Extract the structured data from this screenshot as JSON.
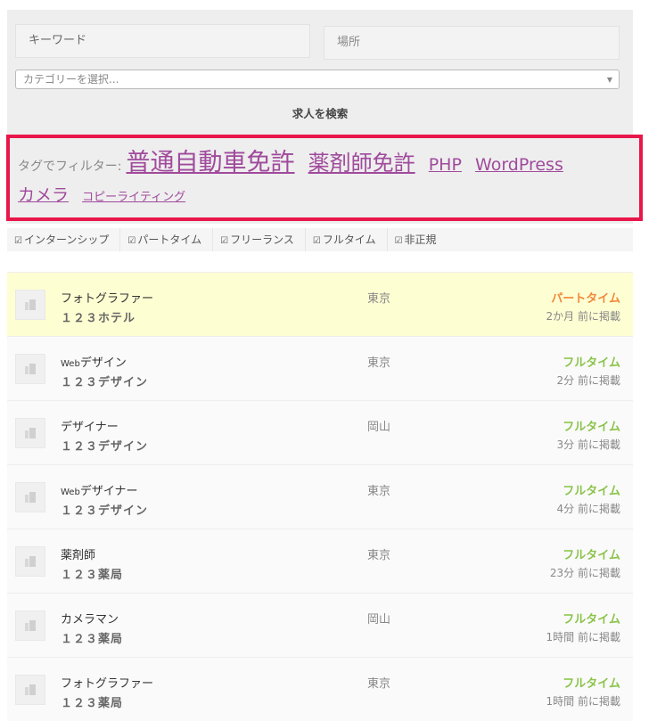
{
  "search": {
    "keyword_placeholder": "キーワード",
    "location_placeholder": "場所",
    "category_placeholder": "カテゴリーを選択...",
    "submit_label": "求人を検索"
  },
  "tags": {
    "label": "タグでフィルター:",
    "items": [
      "普通自動車免許",
      "薬剤師免許",
      "PHP",
      "WordPress",
      "カメラ",
      "コピーライティング"
    ]
  },
  "filters": [
    "インターンシップ",
    "パートタイム",
    "フリーランス",
    "フルタイム",
    "非正規"
  ],
  "jobs": [
    {
      "title": "フォトグラファー",
      "title_prefix": "",
      "company": "１２３ホテル",
      "location": "東京",
      "type": "パートタイム",
      "posted": "2か月 前に掲載"
    },
    {
      "title": "デザイン",
      "title_prefix": "Web",
      "company": "１２３デザイン",
      "location": "東京",
      "type": "フルタイム",
      "posted": "2分 前に掲載"
    },
    {
      "title": "デザイナー",
      "title_prefix": "",
      "company": "１２３デザイン",
      "location": "岡山",
      "type": "フルタイム",
      "posted": "3分 前に掲載"
    },
    {
      "title": "デザイナー",
      "title_prefix": "Web",
      "company": "１２３デザイン",
      "location": "東京",
      "type": "フルタイム",
      "posted": "4分 前に掲載"
    },
    {
      "title": "薬剤師",
      "title_prefix": "",
      "company": "１２３薬局",
      "location": "東京",
      "type": "フルタイム",
      "posted": "23分 前に掲載"
    },
    {
      "title": "カメラマン",
      "title_prefix": "",
      "company": "１２３薬局",
      "location": "岡山",
      "type": "フルタイム",
      "posted": "1時間 前に掲載"
    },
    {
      "title": "フォトグラファー",
      "title_prefix": "",
      "company": "１２３薬局",
      "location": "東京",
      "type": "フルタイム",
      "posted": "1時間 前に掲載"
    }
  ],
  "colors": {
    "highlight_border": "#e8164a",
    "tag_link": "#a04a9c",
    "full_time": "#8bc34a",
    "part_time": "#f0893a"
  }
}
